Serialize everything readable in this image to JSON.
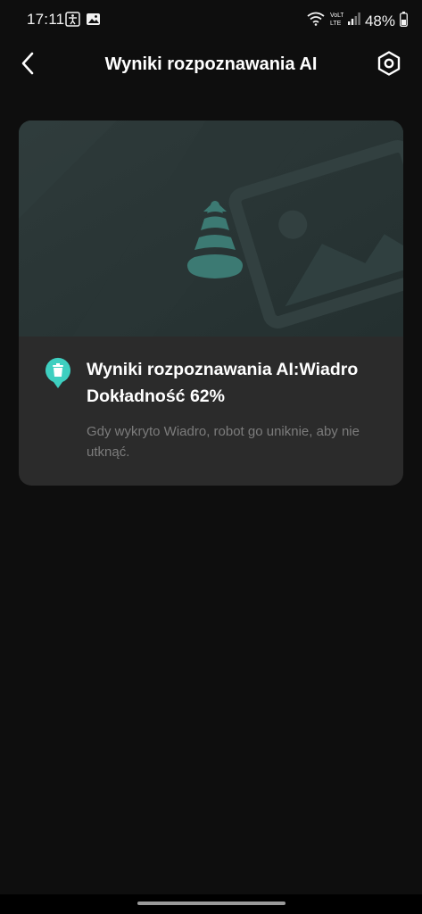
{
  "status_bar": {
    "time": "17:11",
    "battery": "48%",
    "icons": [
      "accessibility-icon",
      "gallery-icon",
      "wifi-icon",
      "volte-lte-icon",
      "signal-icon",
      "battery-icon"
    ]
  },
  "header": {
    "title": "Wyniki rozpoznawania AI",
    "back_icon": "chevron-left-icon",
    "settings_icon": "settings-icon"
  },
  "result_card": {
    "image_icon": "cone-placeholder-icon",
    "pin_icon": "trash-bin-icon",
    "title_line1": "Wyniki rozpoznawania AI:Wiadro",
    "title_line2": "Dokładność 62%",
    "description": "Gdy wykryto Wiadro, robot go uniknie, aby nie utknąć.",
    "accent_color": "#3ecfc0"
  }
}
